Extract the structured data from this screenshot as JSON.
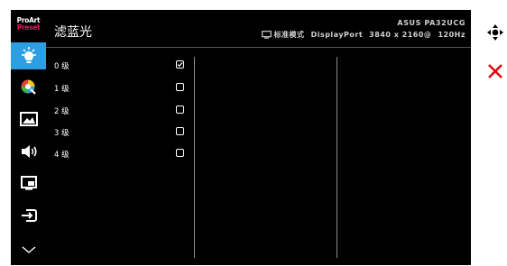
{
  "brand": {
    "line1": "ProArt",
    "line2": "Preset"
  },
  "sidebar": {
    "items": [
      {
        "icon": "blue-light-filter-icon",
        "active": true
      },
      {
        "icon": "color-icon",
        "active": false
      },
      {
        "icon": "image-icon",
        "active": false
      },
      {
        "icon": "sound-icon",
        "active": false
      },
      {
        "icon": "pip-icon",
        "active": false
      },
      {
        "icon": "input-select-icon",
        "active": false
      },
      {
        "icon": "chevron-down-icon",
        "active": false
      }
    ]
  },
  "header": {
    "title": "滤蓝光",
    "model": "ASUS PA32UCG",
    "mode": "标准模式",
    "input": "DisplayPort",
    "resolution": "3840 x 2160@",
    "refresh": "120Hz"
  },
  "options": [
    {
      "label": "0 级",
      "checked": true
    },
    {
      "label": "1 级",
      "checked": false
    },
    {
      "label": "2 级",
      "checked": false
    },
    {
      "label": "3 级",
      "checked": false
    },
    {
      "label": "4 级",
      "checked": false
    }
  ],
  "colors": {
    "accent": "#2b9fe1",
    "close": "#e30613",
    "brand_red": "#d81e5b"
  }
}
